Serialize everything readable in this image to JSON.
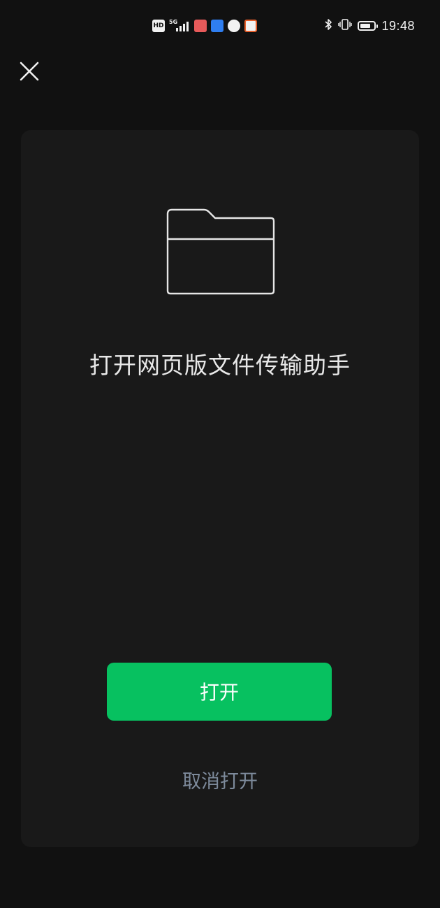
{
  "status_bar": {
    "badge": "HD",
    "network": "5G",
    "time": "19:48",
    "battery_level": 0.8,
    "icons": [
      "hd-icon",
      "signal-5g-icon",
      "app-notification-red-icon",
      "cloud-app-icon",
      "hand-app-icon",
      "app-orange-icon",
      "bluetooth-icon",
      "vibrate-icon",
      "battery-icon"
    ]
  },
  "header": {
    "close_icon": "close-icon"
  },
  "dialog": {
    "icon": "folder-icon",
    "title": "打开网页版文件传输助手",
    "open_label": "打开",
    "cancel_label": "取消打开"
  },
  "colors": {
    "background": "#111111",
    "card": "#191919",
    "primary": "#07c160",
    "cancel_text": "#7d8a9b",
    "title_text": "#e8e8e8"
  }
}
